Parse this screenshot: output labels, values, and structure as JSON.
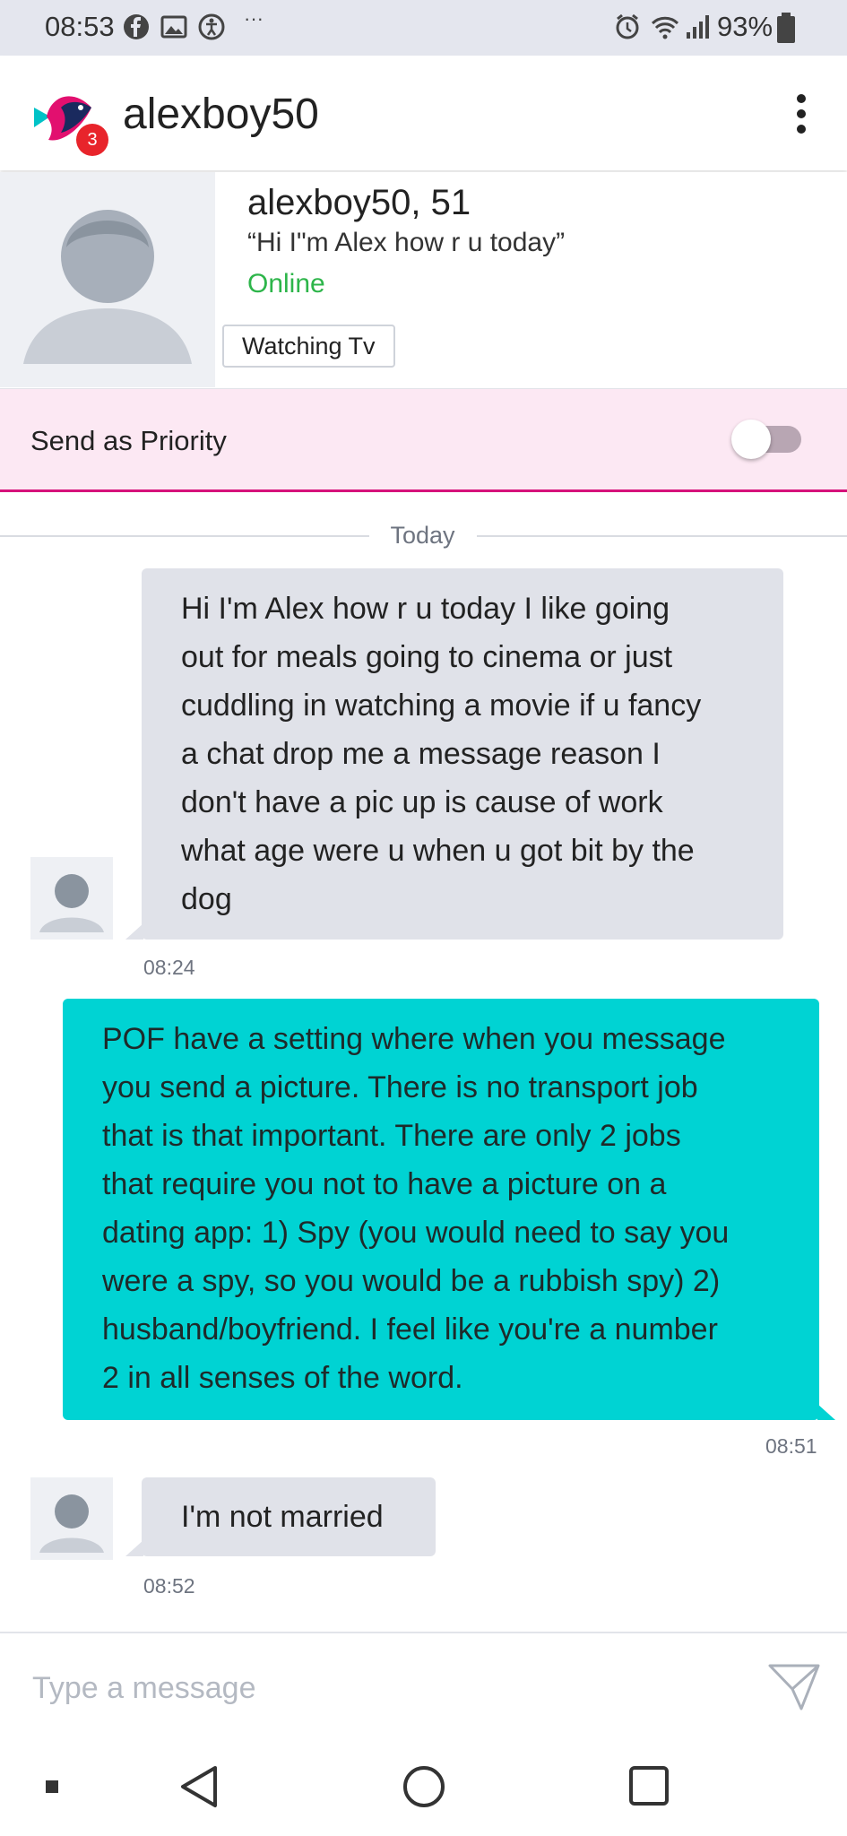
{
  "status_bar": {
    "time": "08:53",
    "battery": "93%",
    "left_icons": [
      "facebook-icon",
      "gallery-icon",
      "accessibility-icon",
      "more-dots-icon"
    ],
    "right_icons": [
      "alarm-icon",
      "wifi-icon",
      "signal-icon",
      "battery-icon"
    ]
  },
  "header": {
    "title": "alexboy50",
    "notification_count": "3",
    "menu_icon": "more-vertical-icon"
  },
  "profile": {
    "name_age": "alexboy50, 51",
    "tagline": "“Hi I\"m Alex how r u today”",
    "status": "Online",
    "activity": "Watching Tv"
  },
  "priority": {
    "label": "Send as Priority",
    "enabled": false
  },
  "chat": {
    "date_divider": "Today",
    "messages": [
      {
        "direction": "incoming",
        "lines": [
          "Hi I'm Alex how r u today I like going",
          "out for meals going to cinema or just",
          "cuddling in watching a movie if u fancy",
          "a chat drop me a message reason I",
          "don't have a pic up is cause of work",
          "what age were u when u got bit by the",
          "dog"
        ],
        "time": "08:24"
      },
      {
        "direction": "outgoing",
        "lines": [
          "POF have a setting where when you message",
          "you send a picture. There is no transport job",
          "that is that important. There are only 2 jobs",
          "that require you not to have a picture on a",
          "dating app: 1) Spy (you would need to say you",
          "were a spy, so you would be a rubbish spy) 2)",
          "husband/boyfriend. I feel like you're a number",
          "2 in all senses of the word."
        ],
        "time": "08:51"
      },
      {
        "direction": "incoming",
        "lines": [
          "I'm not married"
        ],
        "time": "08:52"
      }
    ]
  },
  "composer": {
    "placeholder": "Type a message",
    "send_icon": "send-icon"
  },
  "colors": {
    "accent_teal": "#00d3d3",
    "online_green": "#2db54a",
    "priority_pink": "#d6127a",
    "badge_red": "#e8242b"
  }
}
